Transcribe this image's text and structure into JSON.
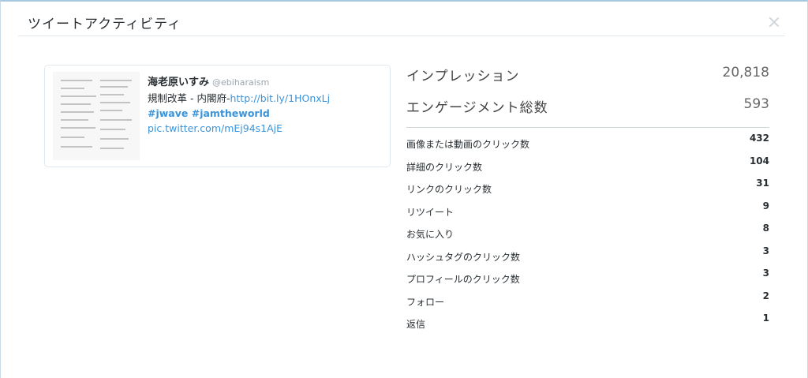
{
  "modal": {
    "title": "ツイートアクティビティ"
  },
  "tweet": {
    "author_name": "海老原いすみ",
    "author_handle": "@ebiharaism",
    "text_prefix": "規制改革 - 内閣府-",
    "link": "http://bit.ly/1HOnxLj",
    "hashtags": "#jwave #jamtheworld",
    "pic_link": "pic.twitter.com/mEj94s1AjE"
  },
  "stats": {
    "impressions_label": "インプレッション",
    "impressions_value": "20,818",
    "engagements_label": "エンゲージメント総数",
    "engagements_value": "593",
    "rows": [
      {
        "label": "画像または動画のクリック数",
        "value": "432"
      },
      {
        "label": "詳細のクリック数",
        "value": "104"
      },
      {
        "label": "リンクのクリック数",
        "value": "31"
      },
      {
        "label": "リツイート",
        "value": "9"
      },
      {
        "label": "お気に入り",
        "value": "8"
      },
      {
        "label": "ハッシュタグのクリック数",
        "value": "3"
      },
      {
        "label": "プロフィールのクリック数",
        "value": "3"
      },
      {
        "label": "フォロー",
        "value": "2"
      },
      {
        "label": "返信",
        "value": "1"
      }
    ]
  }
}
